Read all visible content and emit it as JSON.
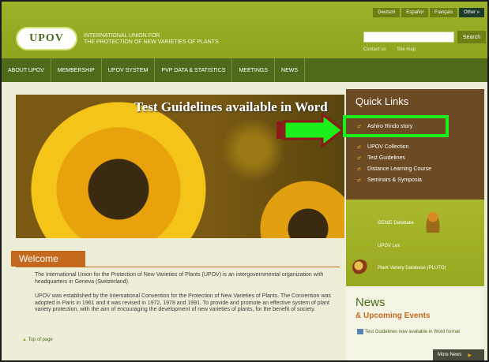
{
  "header": {
    "languages": [
      "Deutsch",
      "Español",
      "Français",
      "Other »"
    ],
    "logo_text": "UPOV",
    "org_line1": "INTERNATIONAL UNION FOR",
    "org_line2": "THE PROTECTION OF NEW VARIETIES OF PLANTS",
    "search_placeholder": "",
    "search_button": "Search",
    "contact_link": "Contact us",
    "sitemap_link": "Site map"
  },
  "nav": {
    "items": [
      "ABOUT UPOV",
      "MEMBERSHIP",
      "UPOV SYSTEM",
      "PVP DATA & STATISTICS",
      "MEETINGS",
      "NEWS"
    ]
  },
  "hero": {
    "title": "Test Guidelines available in Word"
  },
  "welcome": {
    "title": "Welcome",
    "paragraph1": "The International Union for the Protection of New Varieties of Plants (UPOV) is an intergovernmental organization with headquarters in Geneva (Switzerland).",
    "paragraph2": "UPOV was established by the International Convention for the Protection of New Varieties of Plants. The Convention was adopted in Paris in 1961 and it was revised in 1972, 1978 and 1991. To provide and promote an effective system of plant variety protection, with the aim of encouraging the development of new varieties of plants, for the benefit of society.",
    "top_of_page": "Top of page"
  },
  "quick_links": {
    "title": "Quick Links",
    "items": [
      "Ashiro Rindo story",
      "UPOV Collection",
      "Test Guidelines",
      "Distance Learning Course",
      "Seminars & Symposia"
    ]
  },
  "databases": {
    "genie": "GENIE Database",
    "upovlex": "UPOV Lex",
    "pluto": "Plant Variety Database (PLUTO)"
  },
  "news": {
    "title": "News",
    "subtitle": "& Upcoming Events",
    "item": "Test Guidelines now available in Word format",
    "more": "More News"
  },
  "colors": {
    "header_green": "#9db22a",
    "nav_green": "#4e6a1a",
    "quicklinks_brown": "#6b4a24",
    "accent_orange": "#c46a1e",
    "highlight_green": "#1cf01c",
    "arrow_red": "#8b1a1a"
  }
}
